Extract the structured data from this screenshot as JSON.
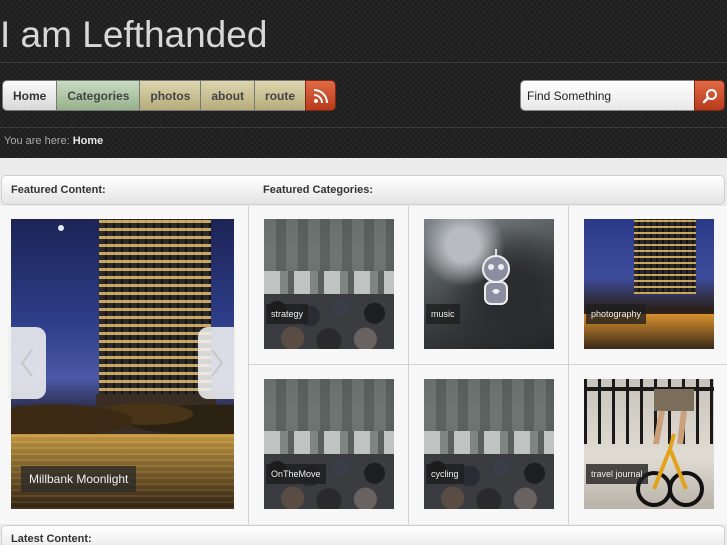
{
  "site": {
    "title": "I am Lefthanded"
  },
  "nav": {
    "items": [
      {
        "label": "Home"
      },
      {
        "label": "Categories"
      },
      {
        "label": "photos"
      },
      {
        "label": "about"
      },
      {
        "label": "route"
      }
    ],
    "rss_icon": "rss-icon"
  },
  "search": {
    "value": "Find Something",
    "icon": "search-icon"
  },
  "breadcrumb": {
    "prefix": "You are here:",
    "current": "Home"
  },
  "featured": {
    "content_heading": "Featured Content:",
    "categories_heading": "Featured Categories:",
    "slide_caption": "Millbank Moonlight",
    "categories": [
      {
        "label": "strategy"
      },
      {
        "label": "music"
      },
      {
        "label": "photography"
      },
      {
        "label": "OnTheMove"
      },
      {
        "label": "cycling"
      },
      {
        "label": "travel journal"
      }
    ]
  },
  "latest": {
    "heading": "Latest Content:"
  },
  "colors": {
    "accent": "#c9461f",
    "header_bg": "#222222",
    "page_bg": "#ececec"
  }
}
